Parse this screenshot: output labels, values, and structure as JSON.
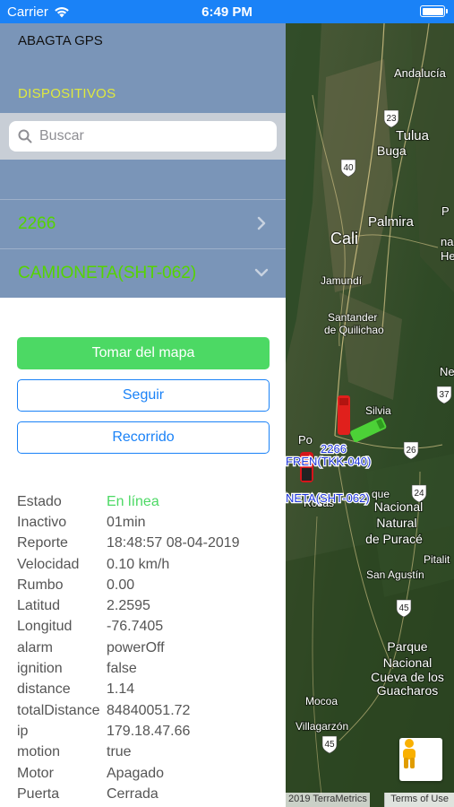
{
  "status_bar": {
    "carrier": "Carrier",
    "time": "6:49 PM"
  },
  "panel": {
    "app_title": "ABAGTA GPS",
    "section_title": "DISPOSITIVOS",
    "search_placeholder": "Buscar",
    "devices": [
      {
        "name": "2266",
        "state": "collapsed"
      },
      {
        "name": "CAMIONETA(SHT-062)",
        "state": "expanded"
      }
    ],
    "buttons": {
      "take_from_map": "Tomar del mapa",
      "follow": "Seguir",
      "route": "Recorrido"
    },
    "info": [
      {
        "key": "Estado",
        "value": "En línea",
        "highlight": true
      },
      {
        "key": "Inactivo",
        "value": "01min"
      },
      {
        "key": "Reporte",
        "value": "18:48:57 08-04-2019"
      },
      {
        "key": "Velocidad",
        "value": "0.10 km/h"
      },
      {
        "key": "Rumbo",
        "value": "0.00"
      },
      {
        "key": "Latitud",
        "value": "2.2595"
      },
      {
        "key": "Longitud",
        "value": "-76.7405"
      },
      {
        "key": "alarm",
        "value": "powerOff"
      },
      {
        "key": "ignition",
        "value": "false"
      },
      {
        "key": "distance",
        "value": "1.14"
      },
      {
        "key": "totalDistance",
        "value": "84840051.72"
      },
      {
        "key": "ip",
        "value": "179.18.47.66"
      },
      {
        "key": "motion",
        "value": "true"
      },
      {
        "key": "Motor",
        "value": "Apagado"
      },
      {
        "key": "Puerta",
        "value": "Cerrada"
      }
    ]
  },
  "map": {
    "places": {
      "andalucia": "Andalucía",
      "tulua": "Tulua",
      "buga": "Buga",
      "palmira": "Palmira",
      "cali": "Cali",
      "jamundi": "Jamundí",
      "santander1": "Santander",
      "santander2": "de Quilichao",
      "silvia": "Silvia",
      "popayan": "Po",
      "parque1_l1": "Parque",
      "parque1_l2": "Nacional",
      "parque1_l3": "Natural",
      "parque1_l4": "de Puracé",
      "san_agustin": "San Agustín",
      "pitalito": "Pitalit",
      "parque2_l1": "Parque",
      "parque2_l2": "Nacional",
      "parque2_l3": "Cueva de los",
      "parque2_l4": "Guacharos",
      "mocoa": "Mocoa",
      "villagarzon": "Villagarzón",
      "rosas": "Rosas",
      "p_edge": "P",
      "na_edge": "na",
      "he_edge": "He",
      "ne_edge": "Ne",
      "que_edge": "que"
    },
    "road_shields": [
      "23",
      "40",
      "37",
      "26",
      "24",
      "45",
      "45"
    ],
    "vehicles": {
      "v1_label": "2266",
      "v2_label": "FREN(TKK-040)",
      "v3_label": "NETA(SHT-062)"
    },
    "copyright": "2019 TerraMetrics",
    "terms": "Terms of Use"
  },
  "colors": {
    "status_bar": "#1a82f7",
    "panel_header": "#7a95b8",
    "device_text": "#55d400",
    "section_title": "#dfe93e",
    "button_green": "#4cd964",
    "button_blue": "#1a82f7"
  }
}
